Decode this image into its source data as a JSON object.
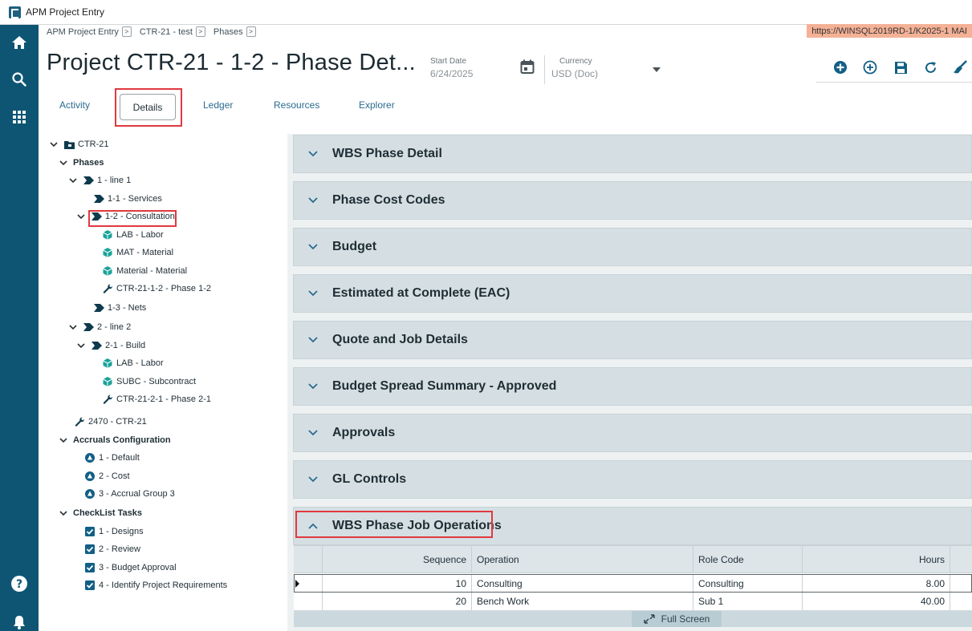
{
  "window": {
    "title": "APM Project Entry"
  },
  "rail": {
    "items": [
      "home-icon",
      "search-icon",
      "apps-grid-icon",
      "help-icon",
      "notifications-icon"
    ]
  },
  "breadcrumb": [
    "APM Project Entry",
    "CTR-21 - test",
    "Phases"
  ],
  "server": {
    "label": "https://WINSQL2019RD-1/K2025-1   MAI"
  },
  "header": {
    "title": "Project CTR-21 - 1-2 - Phase Det...",
    "start_date_label": "Start Date",
    "start_date_value": "6/24/2025",
    "currency_label": "Currency",
    "currency_value": "USD (Doc)"
  },
  "tabs": [
    {
      "label": "Activity"
    },
    {
      "label": "Details"
    },
    {
      "label": "Ledger"
    },
    {
      "label": "Resources"
    },
    {
      "label": "Explorer"
    }
  ],
  "tree": [
    {
      "label": "CTR-21"
    },
    {
      "label": "Phases"
    },
    {
      "label": "1 - line 1"
    },
    {
      "label": "1-1 - Services"
    },
    {
      "label": "1-2 - Consultation"
    },
    {
      "label": "LAB - Labor"
    },
    {
      "label": "MAT - Material"
    },
    {
      "label": "Material - Material"
    },
    {
      "label": "CTR-21-1-2 - Phase 1-2"
    },
    {
      "label": "1-3 - Nets"
    },
    {
      "label": "2 - line 2"
    },
    {
      "label": "2-1 - Build"
    },
    {
      "label": "LAB - Labor"
    },
    {
      "label": "SUBC - Subcontract"
    },
    {
      "label": "CTR-21-2-1 - Phase 2-1"
    },
    {
      "label": "2470 - CTR-21"
    },
    {
      "label": "Accruals Configuration"
    },
    {
      "label": "1 - Default"
    },
    {
      "label": "2 - Cost"
    },
    {
      "label": "3 - Accrual Group 3"
    },
    {
      "label": "CheckList Tasks"
    },
    {
      "label": "1 - Designs"
    },
    {
      "label": "2 - Review"
    },
    {
      "label": "3 - Budget Approval"
    },
    {
      "label": "4 - Identify Project Requirements"
    }
  ],
  "panels": [
    {
      "title": "WBS Phase Detail"
    },
    {
      "title": "Phase Cost Codes"
    },
    {
      "title": "Budget"
    },
    {
      "title": "Estimated at Complete (EAC)"
    },
    {
      "title": "Quote and Job Details"
    },
    {
      "title": "Budget Spread Summary - Approved"
    },
    {
      "title": "Approvals"
    },
    {
      "title": "GL Controls"
    },
    {
      "title": "WBS Phase Job Operations"
    }
  ],
  "grid": {
    "columns": [
      "Sequence",
      "Operation",
      "Role Code",
      "Hours"
    ],
    "rows": [
      {
        "sequence": "10",
        "operation": "Consulting",
        "role": "Consulting",
        "hours": "8.00"
      },
      {
        "sequence": "20",
        "operation": "Bench Work",
        "role": "Sub 1",
        "hours": "40.00"
      }
    ],
    "fullscreen_label": "Full Screen"
  },
  "colors": {
    "rail": "#0e5574",
    "accent": "#2b6b8f",
    "highlight": "#e0393f",
    "panel": "#d5dfe3"
  }
}
